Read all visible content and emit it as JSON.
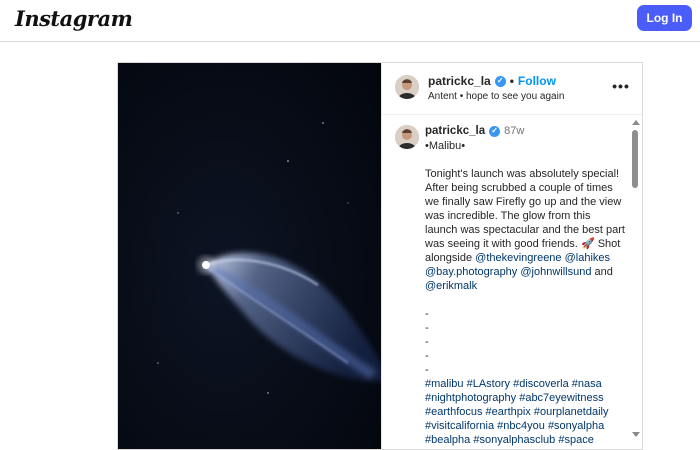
{
  "brand": {
    "logo_text": "Instagram"
  },
  "topbar": {
    "login_label": "Log In"
  },
  "post": {
    "header": {
      "username": "patrickc_la",
      "verified_icon": "verified-icon",
      "separator": "•",
      "follow_label": "Follow",
      "subtitle": "Antent • hope to see you again",
      "more_icon": "more-options-icon"
    },
    "caption": {
      "username": "patrickc_la",
      "time": "87w",
      "location": "•Malibu•",
      "body": "Tonight's launch was absolutely special! After being scrubbed a couple of times we finally saw Firefly go up and the view was incredible. The glow from this launch was spectacular and the best part was seeing it with good friends.",
      "rocket_emoji": "🚀",
      "shot_text": "Shot alongside",
      "mentions": [
        "@thekevingreene",
        "@lahikes",
        "@bay.photography",
        "@johnwillsund",
        "@erikmalk"
      ],
      "and_text": "and",
      "dashes": [
        "-",
        "-",
        "-",
        "-",
        "-"
      ],
      "hashtags": [
        "#malibu",
        "#LAstory",
        "#discoverla",
        "#nasa",
        "#nightphotography",
        "#abc7eyewitness",
        "#earthfocus",
        "#earthpix",
        "#ourplanetdaily",
        "#visitcalifornia",
        "#nbc4you",
        "#sonyalpha",
        "#bealpha",
        "#sonyalphasclub",
        "#space"
      ]
    }
  },
  "colors": {
    "accent": "#4a5df9",
    "follow": "#0095f6",
    "link": "#00376b",
    "verified": "#3897f0",
    "photo_bg": "#060a14"
  }
}
